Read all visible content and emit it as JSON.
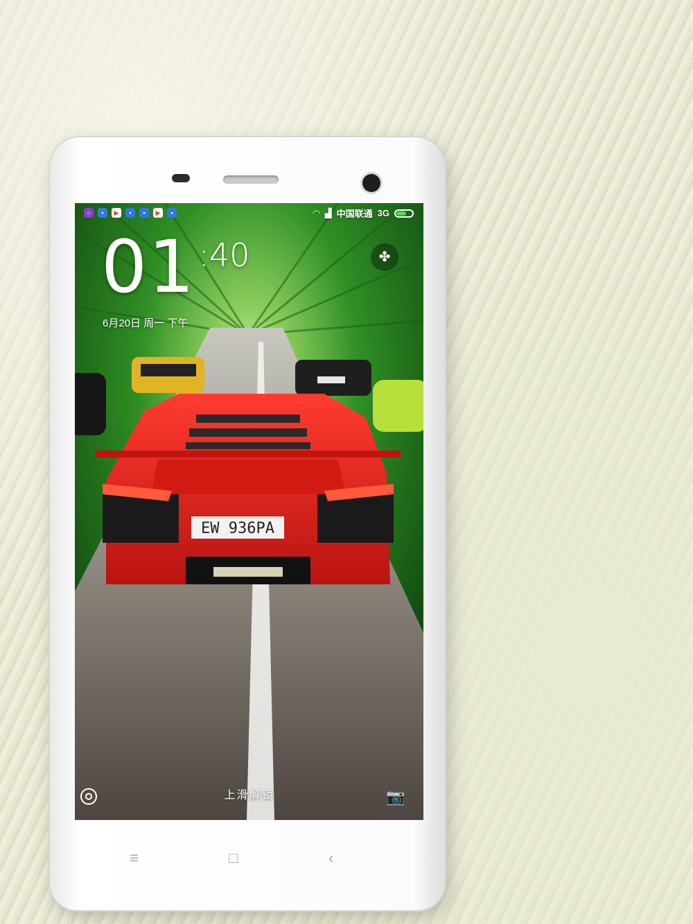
{
  "status_bar": {
    "notification_icons": [
      "app-icon",
      "message-icon",
      "play-store-icon",
      "message-icon",
      "message-icon",
      "play-store-icon",
      "message-icon"
    ],
    "carrier": "中国联通",
    "network": "3G",
    "battery_color": "#4cdc4c"
  },
  "lockscreen": {
    "clock_hour_minute": "01",
    "clock_minute": ":40",
    "date": "6月20日 周一 下午",
    "unlock_hint": "上滑解锁",
    "plate": "EW 936PA",
    "theme_button_icon": "clover-icon",
    "left_shortcut_icon": "circle-shortcut-icon",
    "right_shortcut_icon": "camera-icon"
  },
  "hardware_keys": {
    "menu": "≡",
    "home": "□",
    "back": "‹"
  }
}
